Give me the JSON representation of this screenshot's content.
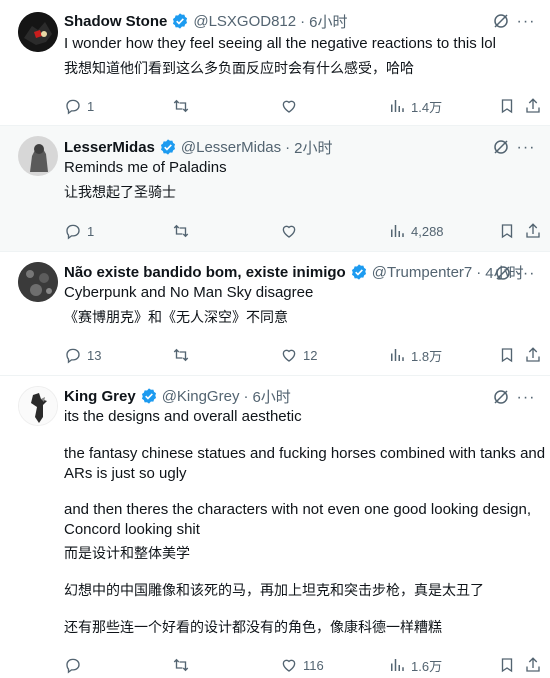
{
  "icons": {
    "verified": "verified-badge-icon",
    "grok": "grok-icon",
    "more": "more-options-icon",
    "reply": "reply-icon",
    "retweet": "retweet-icon",
    "like": "like-icon",
    "views": "views-icon",
    "bookmark": "bookmark-icon",
    "share": "share-icon"
  },
  "colors": {
    "verified": "#1d9bf0",
    "muted": "#536471",
    "text": "#0f1419"
  },
  "tweets": [
    {
      "name": "Shadow Stone",
      "handle": "@LSXGOD812",
      "time": "6小时",
      "lines": [
        "I wonder how they feel seeing all the negative reactions to this lol",
        "我想知道他们看到这么多负面反应时会有什么感受，哈哈"
      ],
      "replies": "1",
      "retweets": "",
      "likes": "",
      "views": "1.4万"
    },
    {
      "name": "LesserMidas",
      "handle": "@LesserMidas",
      "time": "2小时",
      "lines": [
        "Reminds me of Paladins",
        "让我想起了圣骑士"
      ],
      "replies": "1",
      "retweets": "",
      "likes": "",
      "views": "4,288"
    },
    {
      "name": "Não existe bandido bom, existe inimigo",
      "handle": "@Trumpenter7",
      "time": "4小时",
      "lines": [
        "Cyberpunk and No Man Sky disagree",
        "《赛博朋克》和《无人深空》不同意"
      ],
      "replies": "13",
      "retweets": "",
      "likes": "12",
      "views": "1.8万"
    },
    {
      "name": "King Grey",
      "handle": "@KingGrey",
      "time": "6小时",
      "lines": [
        "its the designs and overall aesthetic",
        "the fantasy chinese statues and fucking horses combined with tanks and",
        "ARs  is just so ugly",
        "and then theres the characters with not even one good looking design,",
        "Concord looking shit",
        "而是设计和整体美学",
        "幻想中的中国雕像和该死的马，再加上坦克和突击步枪，真是太丑了",
        "还有那些连一个好看的设计都没有的角色，像康科德一样糟糕"
      ],
      "replies": "",
      "retweets": "",
      "likes": "116",
      "views": "1.6万"
    }
  ]
}
